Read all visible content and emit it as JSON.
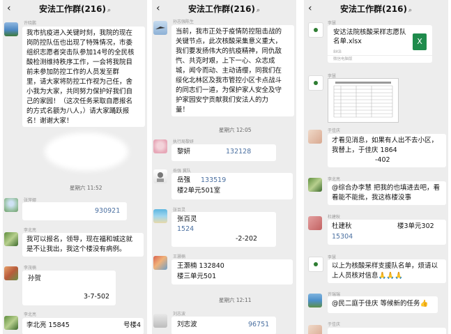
{
  "panel1": {
    "header": {
      "back_icon": "‹",
      "title": "安法工作群(216)",
      "search_icon": "⌕"
    },
    "messages": [
      {
        "nick": "许晓鹏",
        "lines": [
          "我市抗疫进入关键时刻，我院的现在",
          "岗防控队伍也出现了特殊情况，市委",
          "组织志愿者突击队参加14号的全民核",
          "酸检测维持秩序工作，一会将我院目",
          "前未参加防控工作的人员发至群",
          "里，请大家将防控工作视为己任，舍",
          "小我为大家，共同努力保护好我们自",
          "己的家园！（这次任务采取自愿报名",
          "的方式名额为八人，）请大家踊跃报",
          "名！谢谢大家！"
        ]
      },
      {
        "time": "星期六 11:52"
      },
      {
        "nick": "张萍娜",
        "lines": [
          "930921"
        ]
      },
      {
        "nick": "李北亮",
        "lines": [
          "我可以报名，领导，现在福和城这就",
          "是不让我出，我这个楼没有病例。"
        ]
      },
      {
        "nick": "李茂楠",
        "lines": [
          "孙贺",
          "3-7-502"
        ]
      },
      {
        "nick": "李北亮",
        "lines": [
          "李北亮 15845",
          "号楼4"
        ]
      }
    ]
  },
  "panel2": {
    "header": {
      "back_icon": "‹",
      "title": "安法工作群(216)",
      "search_icon": "⌕"
    },
    "messages": [
      {
        "nick": "孙志强陈生",
        "lines": [
          "当前，我市正处于疫情防控阻击战的",
          "关键节点，此次核酸采集意义重大，",
          "我们要发扬伟大的抗疫精神，同仇敌",
          "忾、共克时艰，上下一心、众志成",
          "城，闻令而动、主动请缨，同我们在",
          "绥化北林区及我市管控小区卡点战斗",
          "的同志们一道，为保护家人安全及守",
          "护家园安宁贡献我们安法人的力",
          "量！"
        ]
      },
      {
        "time": "星期六 12:05"
      },
      {
        "nick": "执行局黎妍",
        "lines": [
          "黎妍",
          "132128"
        ]
      },
      {
        "nick": "岳强 冀队",
        "lines": [
          "岳强",
          "133519",
          "楼2单元501室"
        ]
      },
      {
        "nick": "张百灵",
        "lines": [
          "张百灵",
          "1524",
          "-2-202"
        ]
      },
      {
        "nick": "王灏楠",
        "lines": [
          "王灏楠 132840",
          "楼三单元501"
        ]
      },
      {
        "time": "星期六 12:11"
      },
      {
        "nick": "刘志波",
        "lines": [
          "刘志波",
          "96751"
        ]
      }
    ]
  },
  "panel3": {
    "header": {
      "back_icon": "‹",
      "title": "安法工作群(216)",
      "search_icon": "⌕"
    },
    "messages": [
      {
        "nick": "李慧",
        "file_name_lines": [
          "安达法院核酸采样志愿队",
          "名单.xlsx"
        ],
        "file_size": "8KB",
        "file_source": "微信电脑版",
        "file_icon": "X"
      },
      {
        "nick": "李慧",
        "image": "spreadsheet-screenshot"
      },
      {
        "nick": "于佳庆",
        "lines": [
          "才看见消息，如果有人出不去小区，",
          "我替上，于佳庆 1864",
          "-402"
        ]
      },
      {
        "nick": "李北亮",
        "lines": [
          "@综合办李慧 把我的也填进去吧，看",
          "看能不能批，我这栋楼没事"
        ]
      },
      {
        "nick": "杜建秋",
        "lines": [
          "杜建秋",
          "楼3单元302",
          "15304"
        ]
      },
      {
        "nick": "李慧",
        "lines": [
          "以上为核酸采样支援队名单，烦请以",
          "上人员核对信息🙏🙏🙏"
        ]
      },
      {
        "nick": "许瑞瑞",
        "lines": [
          "@民二庭于佳庆 等候新的任务👍"
        ]
      },
      {
        "nick": "于佳庆",
        "lines": []
      }
    ]
  }
}
